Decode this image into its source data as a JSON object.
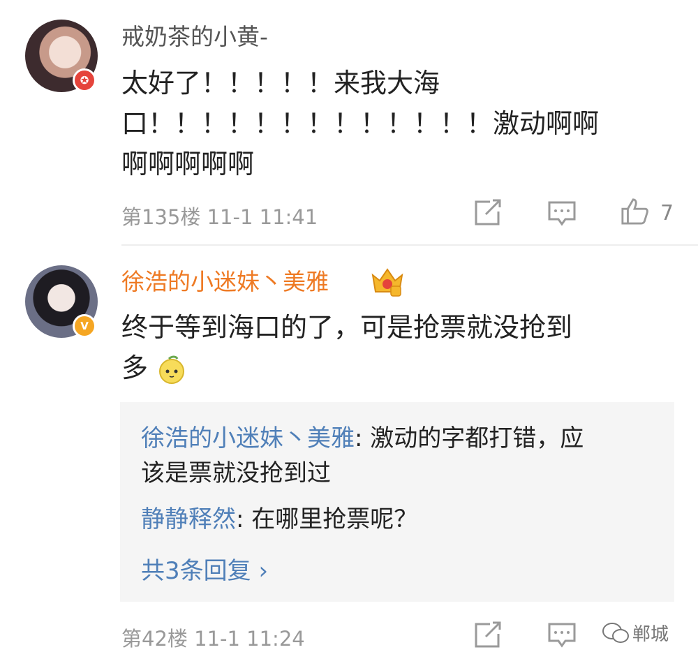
{
  "comments": [
    {
      "username": "戒奶茶的小黄-",
      "text_lines": [
        "太好了！！！！！来我大海",
        "口！！！！！！！！！！！！！激动啊啊",
        "啊啊啊啊啊"
      ],
      "floor": "第135楼",
      "time": "11-1 11:41",
      "like_count": "7"
    },
    {
      "username": "徐浩的小迷妹丶美雅",
      "text_lines": [
        "终于等到海口的了，可是抢票就没抢到",
        "多"
      ],
      "replies": [
        {
          "name": "徐浩的小迷妹丶美雅",
          "text": ": 激动的字都打错，应",
          "cont": "该是票就没抢到过"
        },
        {
          "name": "静静释然",
          "text": ": 在哪里抢票呢？"
        }
      ],
      "more_replies": "共3条回复 ›",
      "floor": "第42楼",
      "time": "11-1 11:24"
    }
  ],
  "watermark": "郸城",
  "badge_symbols": {
    "red": "✪",
    "gold": "V"
  },
  "colors": {
    "username_vip": "#ee7a24",
    "reply_name": "#4f7fb8",
    "meta": "#999999"
  }
}
